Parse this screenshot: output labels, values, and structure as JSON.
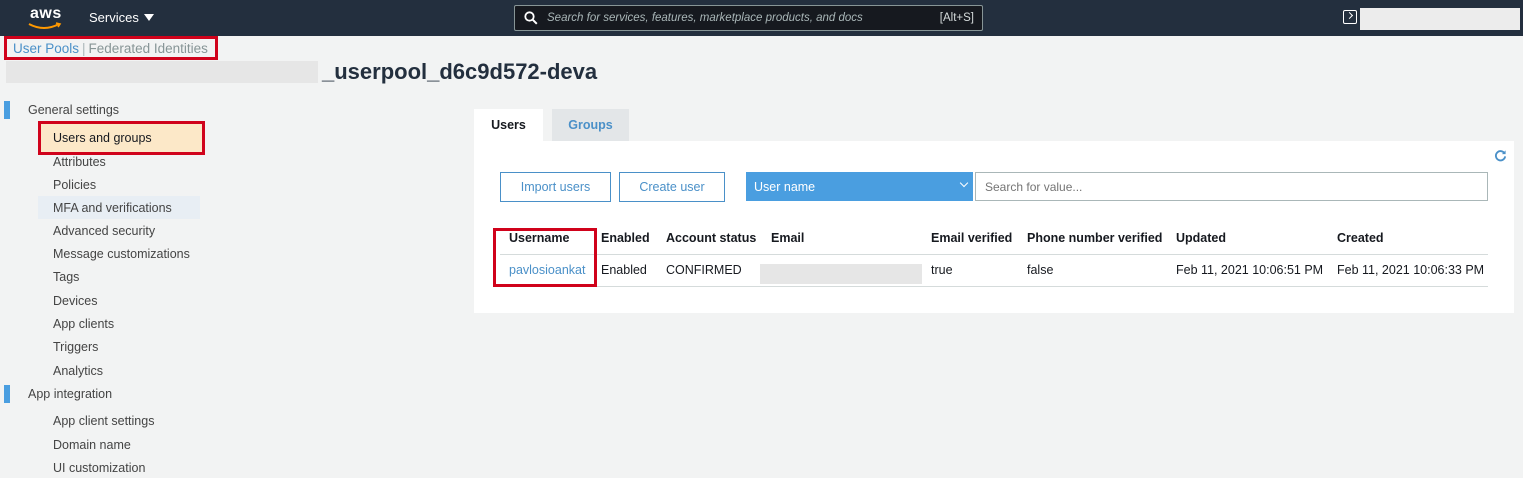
{
  "topbar": {
    "logo_text": "aws",
    "services_label": "Services",
    "search_placeholder": "Search for services, features, marketplace products, and docs",
    "search_shortcut": "[Alt+S]"
  },
  "pool_nav": {
    "user_pools": "User Pools",
    "separator": "|",
    "federated": "Federated Identities"
  },
  "pool_title": "_userpool_d6c9d572-deva",
  "sidebar": {
    "sections": [
      {
        "label": "General settings",
        "items": [
          "Users and groups",
          "Attributes",
          "Policies",
          "MFA and verifications",
          "Advanced security",
          "Message customizations",
          "Tags",
          "Devices",
          "App clients",
          "Triggers",
          "Analytics"
        ]
      },
      {
        "label": "App integration",
        "items": [
          "App client settings",
          "Domain name",
          "UI customization"
        ]
      }
    ]
  },
  "tabs": {
    "users": "Users",
    "groups": "Groups"
  },
  "toolbar": {
    "import_label": "Import users",
    "create_label": "Create user",
    "attribute_selected": "User name",
    "search_placeholder": "Search for value..."
  },
  "table": {
    "headers": [
      "Username",
      "Enabled",
      "Account status",
      "Email",
      "Email verified",
      "Phone number verified",
      "Updated",
      "Created"
    ],
    "rows": [
      [
        "pavlosioankat",
        "Enabled",
        "CONFIRMED",
        "",
        "true",
        "false",
        "Feb 11, 2021 10:06:51 PM",
        "Feb 11, 2021 10:06:33 PM"
      ]
    ]
  },
  "colors": {
    "topbar": "#232f3e",
    "accent": "#4a90c8",
    "highlight_border": "#d0021b",
    "active_nav_bg": "#fce8c8"
  }
}
